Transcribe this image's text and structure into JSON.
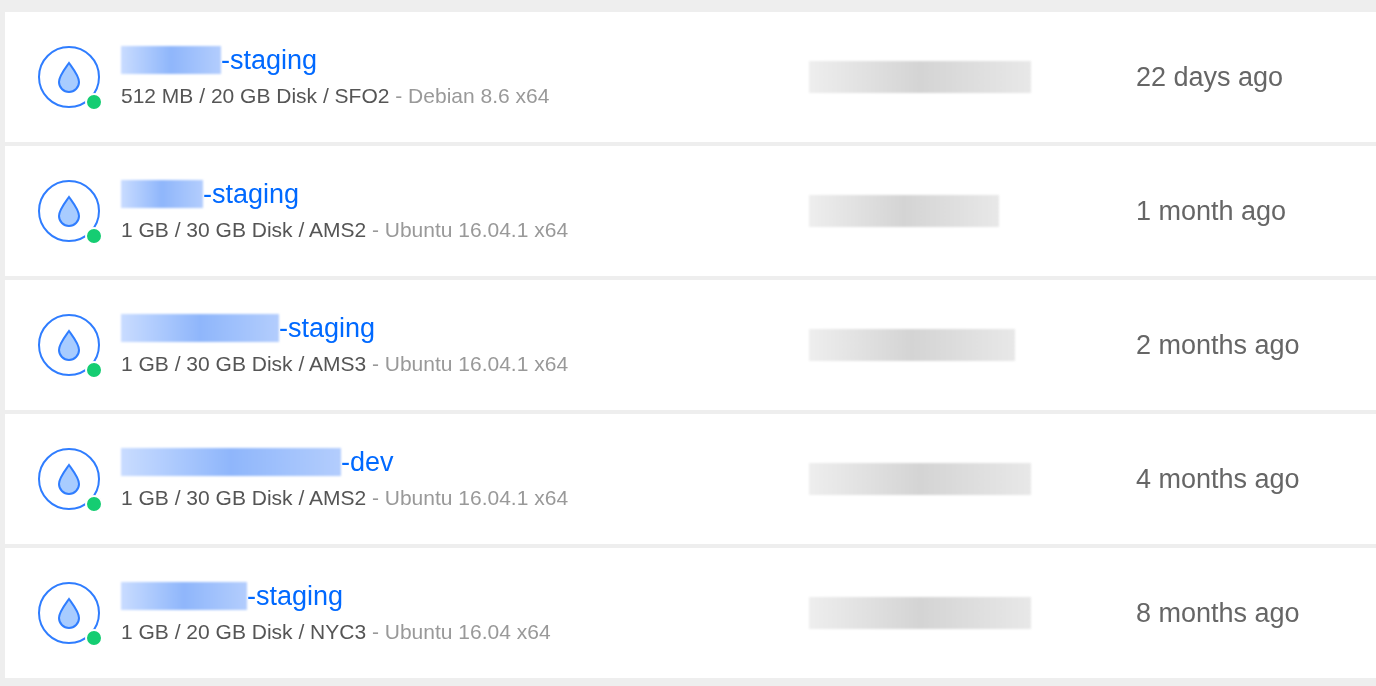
{
  "droplets": [
    {
      "name": "-staging",
      "specs": "512 MB / 20 GB Disk / SFO2",
      "image": "- Debian 8.6 x64",
      "created": "22 days ago"
    },
    {
      "name": "-staging",
      "specs": "1 GB / 30 GB Disk / AMS2",
      "image": "- Ubuntu 16.04.1 x64",
      "created": "1 month ago"
    },
    {
      "name": "-staging",
      "specs": "1 GB / 30 GB Disk / AMS3",
      "image": "- Ubuntu 16.04.1 x64",
      "created": "2 months ago"
    },
    {
      "name": "-dev",
      "specs": "1 GB / 30 GB Disk / AMS2",
      "image": "- Ubuntu 16.04.1 x64",
      "created": "4 months ago"
    },
    {
      "name": "-staging",
      "specs": "1 GB / 20 GB Disk / NYC3",
      "image": "- Ubuntu 16.04 x64",
      "created": "8 months ago"
    }
  ]
}
